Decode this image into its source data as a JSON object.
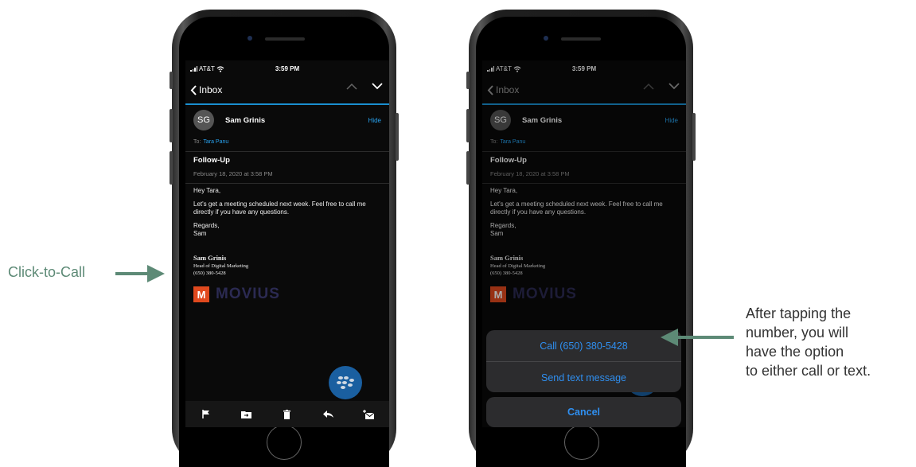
{
  "colors": {
    "accent_blue": "#29a3f0",
    "callout_green": "#5d8a76",
    "brand_orange": "#e0491e",
    "brand_navy": "#2b2a52"
  },
  "left_caption": "Click-to-Call",
  "right_caption": [
    "After tapping the",
    "number, you will",
    "have the option",
    "to either call or text."
  ],
  "phone": {
    "status": {
      "carrier": "AT&T",
      "time": "3:59 PM"
    },
    "nav": {
      "back_label": "Inbox"
    },
    "sender": {
      "initials": "SG",
      "name": "Sam Grinis",
      "hide_label": "Hide"
    },
    "to_label": "To:",
    "recipient": "Tara Panu",
    "subject": "Follow-Up",
    "date": "February 18, 2020 at 3:58 PM",
    "body": [
      "Hey Tara,",
      "Let's get a meeting scheduled next week. Feel free to call me directly if you have any questions.",
      "Regards,",
      "Sam"
    ],
    "signature": {
      "name": "Sam Grinis",
      "title": "Head of Digital Marketing",
      "phone": "(650) 380-5428"
    },
    "logo": {
      "mark": "M",
      "text": "MOVIUS"
    },
    "toolbar_icons": [
      "flag-icon",
      "move-folder-icon",
      "trash-icon",
      "reply-icon",
      "compose-icon"
    ]
  },
  "action_sheet": {
    "call_label": "Call (650) 380-5428",
    "text_label": "Send text message",
    "cancel_label": "Cancel"
  }
}
